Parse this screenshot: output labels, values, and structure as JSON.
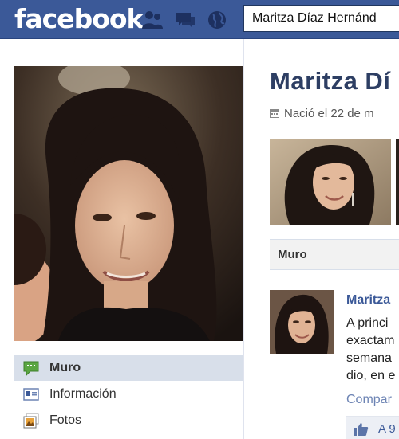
{
  "topbar": {
    "logo": "facebook",
    "search_value": "Maritza Díaz Hernánd",
    "icons": [
      "friend-requests-icon",
      "messages-icon",
      "notifications-globe-icon"
    ]
  },
  "sidebar": {
    "items": [
      {
        "label": "Muro",
        "icon": "wall-speech-bubble-icon",
        "active": true
      },
      {
        "label": "Información",
        "icon": "info-card-icon",
        "active": false
      },
      {
        "label": "Fotos",
        "icon": "photos-icon",
        "active": false
      }
    ]
  },
  "profile": {
    "name": "Maritza Dí",
    "born": "Nació el 22 de m"
  },
  "tabs": {
    "current": "Muro"
  },
  "post": {
    "author": "Maritza",
    "lines": [
      "A princi",
      "exactam",
      "semana",
      "dio, en e"
    ],
    "action": "Compar",
    "likes": "A 9"
  },
  "colors": {
    "brand": "#3b5998",
    "name_color": "#2d3e63",
    "active_nav": "#d8dfea"
  }
}
